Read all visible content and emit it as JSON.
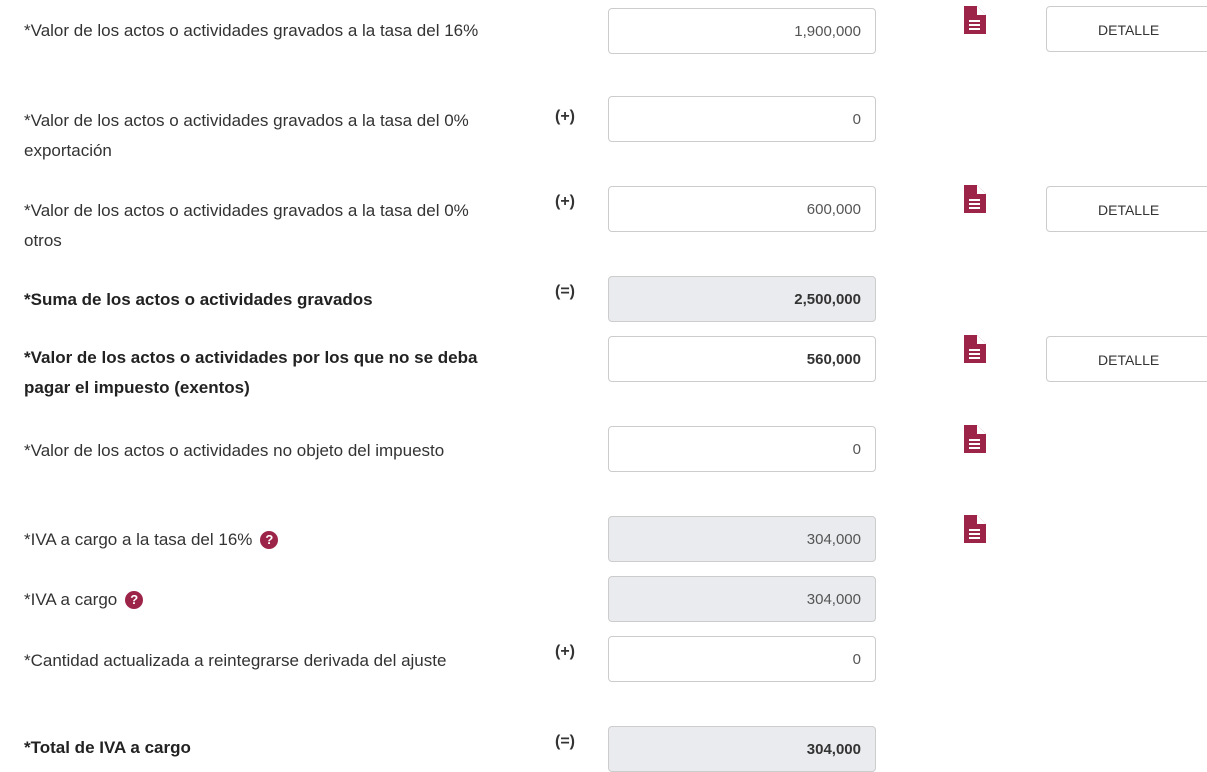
{
  "form": {
    "rows": [
      {
        "label": "*Valor de los actos o actividades gravados a la tasa del 16%",
        "op": "",
        "value": "1,900,000",
        "detail": "DETALLE"
      },
      {
        "label": "*Valor de los actos o actividades gravados a la tasa del 0% exportación",
        "op": "(+)",
        "value": "0"
      },
      {
        "label": "*Valor de los actos o actividades gravados a la tasa del 0% otros",
        "op": "(+)",
        "value": "600,000",
        "detail": "DETALLE"
      },
      {
        "label": "*Suma de los actos o actividades gravados",
        "op": "(=)",
        "value": "2,500,000"
      },
      {
        "label": "*Valor de los actos o actividades por los que no se deba pagar el impuesto (exentos)",
        "op": "",
        "value": "560,000",
        "detail": "DETALLE"
      },
      {
        "label": "*Valor de los actos o actividades no objeto del impuesto",
        "op": "",
        "value": "0"
      },
      {
        "label": "*IVA a cargo a la tasa del 16%",
        "op": "",
        "value": "304,000"
      },
      {
        "label": "*IVA a cargo",
        "op": "",
        "value": "304,000"
      },
      {
        "label": "*Cantidad actualizada a reintegrarse derivada del ajuste",
        "op": "(+)",
        "value": "0"
      },
      {
        "label": "*Total de IVA a cargo",
        "op": "(=)",
        "value": "304,000"
      }
    ]
  },
  "colors": {
    "accent": "#9d2449",
    "readonly_bg": "#e9ebee",
    "border": "#cccccc"
  },
  "icons": {
    "document": "document-icon",
    "help": "question-circle-icon"
  },
  "help_glyph": "?"
}
